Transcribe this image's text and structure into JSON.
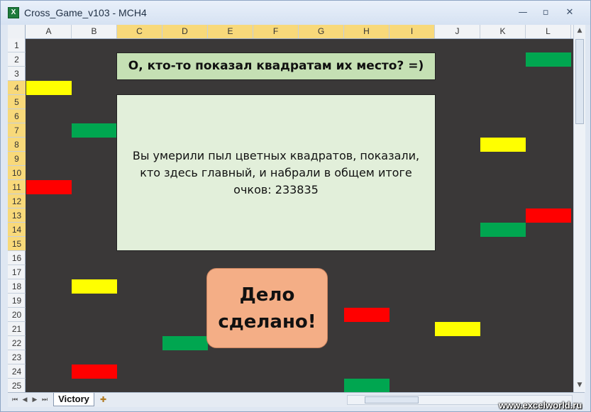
{
  "window": {
    "title": "Cross_Game_v103 - MCH4",
    "app_icon_letter": "X",
    "minimize_glyph": "—",
    "restore_glyph": "▫",
    "close_glyph": "✕"
  },
  "columns": [
    "A",
    "B",
    "C",
    "D",
    "E",
    "F",
    "G",
    "H",
    "I",
    "J",
    "K",
    "L"
  ],
  "selected_columns": [
    "C",
    "D",
    "E",
    "F",
    "G",
    "H",
    "I"
  ],
  "rows": [
    "1",
    "2",
    "3",
    "4",
    "5",
    "6",
    "7",
    "8",
    "9",
    "10",
    "11",
    "12",
    "13",
    "14",
    "15",
    "16",
    "17",
    "18",
    "19",
    "20",
    "21",
    "22",
    "23",
    "24",
    "25"
  ],
  "selected_rows": [
    "4",
    "5",
    "6",
    "7",
    "8",
    "9",
    "10",
    "11",
    "12",
    "13",
    "14",
    "15"
  ],
  "colors": {
    "yellow": "#ffff00",
    "green": "#00a650",
    "red": "#ff0000",
    "background": "#3a3838"
  },
  "blocks": [
    {
      "col": "L",
      "row": "2",
      "color": "green"
    },
    {
      "col": "A",
      "row": "4",
      "color": "yellow"
    },
    {
      "col": "B",
      "row": "7",
      "color": "green"
    },
    {
      "col": "K",
      "row": "8",
      "color": "yellow"
    },
    {
      "col": "A",
      "row": "11",
      "color": "red"
    },
    {
      "col": "L",
      "row": "13",
      "color": "red"
    },
    {
      "col": "K",
      "row": "14",
      "color": "green"
    },
    {
      "col": "B",
      "row": "18",
      "color": "yellow"
    },
    {
      "col": "H",
      "row": "20",
      "color": "red"
    },
    {
      "col": "J",
      "row": "21",
      "color": "yellow"
    },
    {
      "col": "D",
      "row": "22",
      "color": "green"
    },
    {
      "col": "B",
      "row": "24",
      "color": "red"
    },
    {
      "col": "H",
      "row": "25",
      "color": "green"
    }
  ],
  "heading": "О, кто-то показал квадратам их место? =)",
  "message": "Вы умерили пыл цветных квадратов, показали, кто здесь главный, и набрали в общем итоге очков: 233835",
  "done_button": "Дело\nсделано!",
  "sheet_tab": "Victory",
  "watermark": "www.excelworld.ru"
}
